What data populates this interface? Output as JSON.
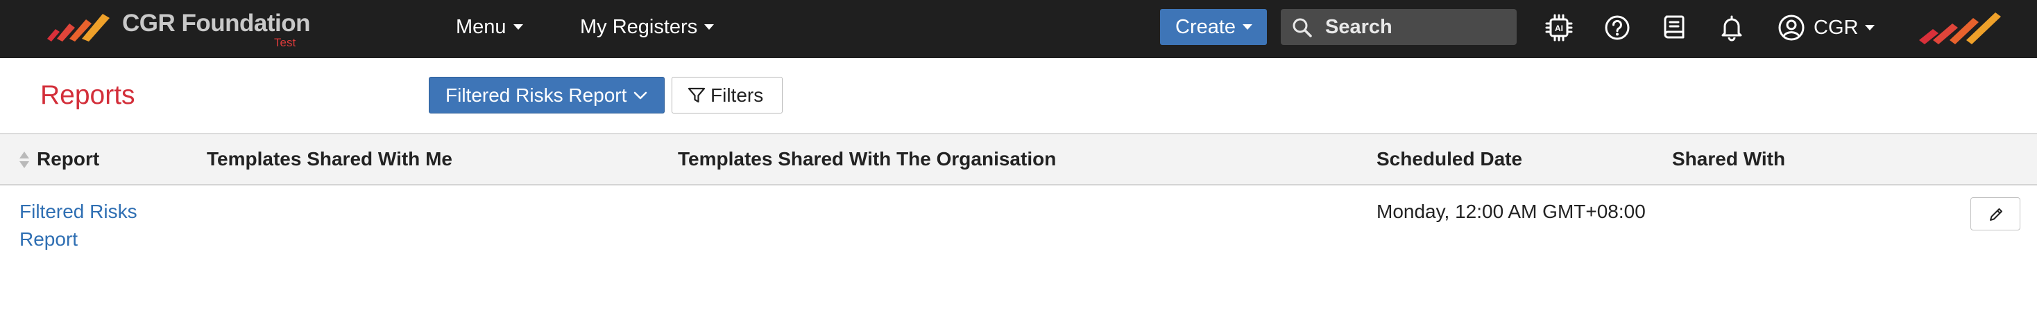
{
  "brand": {
    "name": "CGR Foundation",
    "environment": "Test"
  },
  "nav": {
    "menu_label": "Menu",
    "registers_label": "My Registers",
    "create_label": "Create",
    "search_placeholder": "Search",
    "user_label": "CGR",
    "icons": [
      "ai-chip-icon",
      "help-icon",
      "book-icon",
      "bell-icon",
      "user-circle-icon"
    ]
  },
  "page": {
    "title": "Reports",
    "report_selector_label": "Filtered Risks Report",
    "filters_label": "Filters"
  },
  "table": {
    "columns": [
      "Report",
      "Templates Shared With Me",
      "Templates Shared With The Organisation",
      "Scheduled Date",
      "Shared With"
    ],
    "rows": [
      {
        "report_line1": "Filtered Risks",
        "report_line2": "Report",
        "templates_shared_with_me": "",
        "templates_shared_with_org": "",
        "scheduled_date": "Monday, 12:00 AM GMT+08:00",
        "shared_with": ""
      }
    ]
  },
  "colors": {
    "topbar": "#1f1f1f",
    "primary": "#3e75b7",
    "title_red": "#d32f3a",
    "link": "#2f6fb3"
  }
}
